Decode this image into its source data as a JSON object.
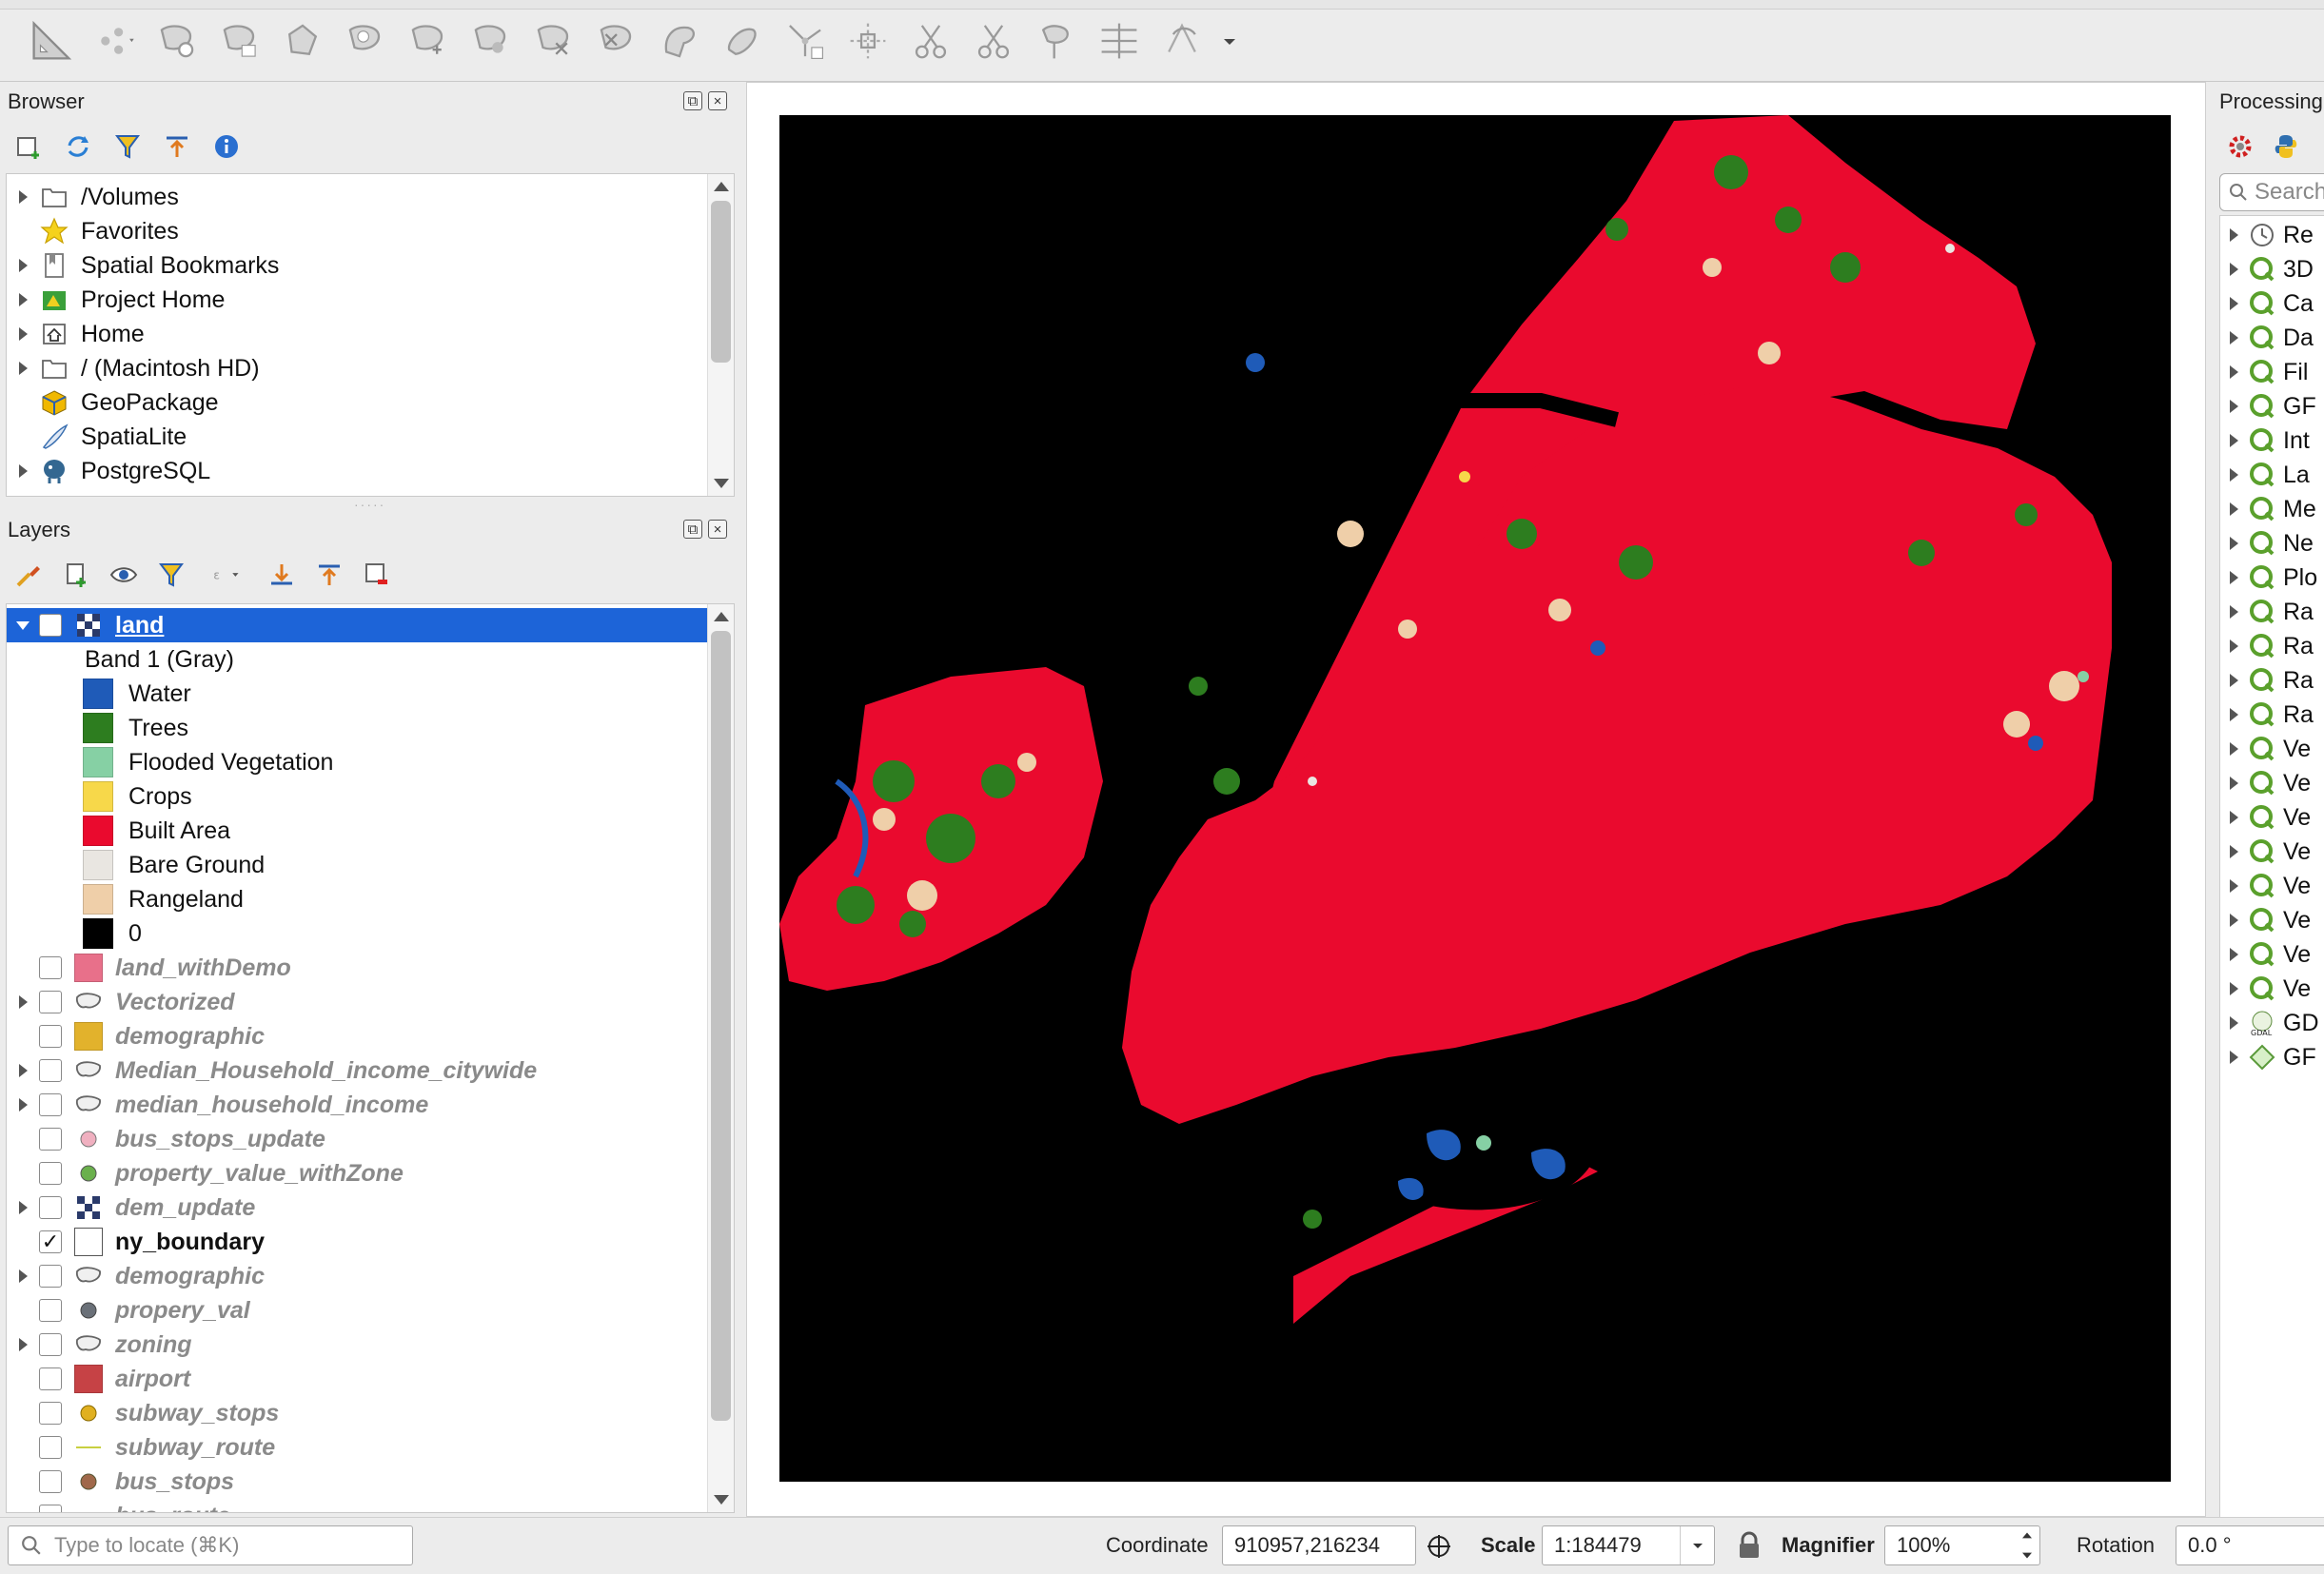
{
  "browser": {
    "title": "Browser",
    "items": [
      {
        "label": "/Volumes",
        "icon": "folder-icon",
        "expandable": true
      },
      {
        "label": "Favorites",
        "icon": "star-icon",
        "expandable": false
      },
      {
        "label": "Spatial Bookmarks",
        "icon": "bookmark-icon",
        "expandable": true
      },
      {
        "label": "Project Home",
        "icon": "project-home-icon",
        "expandable": true
      },
      {
        "label": "Home",
        "icon": "home-icon",
        "expandable": true
      },
      {
        "label": "/ (Macintosh HD)",
        "icon": "folder-icon",
        "expandable": true
      },
      {
        "label": "GeoPackage",
        "icon": "geopackage-icon",
        "expandable": false
      },
      {
        "label": "SpatiaLite",
        "icon": "spatialite-icon",
        "expandable": false
      },
      {
        "label": "PostgreSQL",
        "icon": "postgresql-icon",
        "expandable": true
      }
    ]
  },
  "layers": {
    "title": "Layers",
    "selected_layer": {
      "label": "land",
      "band": "Band 1 (Gray)"
    },
    "legend": [
      {
        "label": "Water",
        "color": "#1f5bb8"
      },
      {
        "label": "Trees",
        "color": "#2d7d1f"
      },
      {
        "label": "Flooded Vegetation",
        "color": "#86d0a4"
      },
      {
        "label": "Crops",
        "color": "#f7d84a"
      },
      {
        "label": "Built Area",
        "color": "#ea0a2e"
      },
      {
        "label": "Bare Ground",
        "color": "#e9e6e1"
      },
      {
        "label": "Rangeland",
        "color": "#efcfa9"
      },
      {
        "label": "0",
        "color": "#000000"
      }
    ],
    "items": [
      {
        "label": "land_withDemo",
        "checked": false,
        "expandable": false,
        "symbol": "fill-pink"
      },
      {
        "label": "Vectorized",
        "checked": false,
        "expandable": true,
        "symbol": "polygon"
      },
      {
        "label": "demographic",
        "checked": false,
        "expandable": false,
        "symbol": "fill-gold"
      },
      {
        "label": "Median_Household_income_citywide",
        "checked": false,
        "expandable": true,
        "symbol": "polygon"
      },
      {
        "label": "median_household_income",
        "checked": false,
        "expandable": true,
        "symbol": "polygon"
      },
      {
        "label": "bus_stops_update",
        "checked": false,
        "expandable": false,
        "symbol": "point-pink"
      },
      {
        "label": "property_value_withZone",
        "checked": false,
        "expandable": false,
        "symbol": "point-green"
      },
      {
        "label": "dem_update",
        "checked": false,
        "expandable": true,
        "symbol": "raster"
      },
      {
        "label": "ny_boundary",
        "checked": true,
        "expandable": false,
        "symbol": "fill-white"
      },
      {
        "label": "demographic",
        "checked": false,
        "expandable": true,
        "symbol": "polygon"
      },
      {
        "label": "propery_val",
        "checked": false,
        "expandable": false,
        "symbol": "point-gray"
      },
      {
        "label": "zoning",
        "checked": false,
        "expandable": true,
        "symbol": "polygon"
      },
      {
        "label": "airport",
        "checked": false,
        "expandable": false,
        "symbol": "fill-red"
      },
      {
        "label": "subway_stops",
        "checked": false,
        "expandable": false,
        "symbol": "point-gold"
      },
      {
        "label": "subway_route",
        "checked": false,
        "expandable": false,
        "symbol": "line-yellow"
      },
      {
        "label": "bus_stops",
        "checked": false,
        "expandable": false,
        "symbol": "point-brown"
      },
      {
        "label": "bus_route",
        "checked": false,
        "expandable": false,
        "symbol": "line-gray"
      }
    ]
  },
  "processing": {
    "title": "Processing",
    "search_placeholder": "Search",
    "items": [
      "Re",
      "3D",
      "Ca",
      "Da",
      "Fil",
      "GF",
      "Int",
      "La",
      "Me",
      "Ne",
      "Plo",
      "Ra",
      "Ra",
      "Ra",
      "Ra",
      "Ve",
      "Ve",
      "Ve",
      "Ve",
      "Ve",
      "Ve",
      "Ve",
      "Ve",
      "GD",
      "GF"
    ]
  },
  "statusbar": {
    "locate_placeholder": "Type to locate (⌘K)",
    "coordinate_label": "Coordinate",
    "coordinate_value": "910957,216234",
    "scale_label": "Scale",
    "scale_value": "1:184479",
    "magnifier_label": "Magnifier",
    "magnifier_value": "100%",
    "rotation_label": "Rotation",
    "rotation_value": "0.0 °"
  },
  "colors": {
    "selection": "#1d64d8",
    "built_area": "#ea0a2e",
    "map_background": "#000000"
  }
}
